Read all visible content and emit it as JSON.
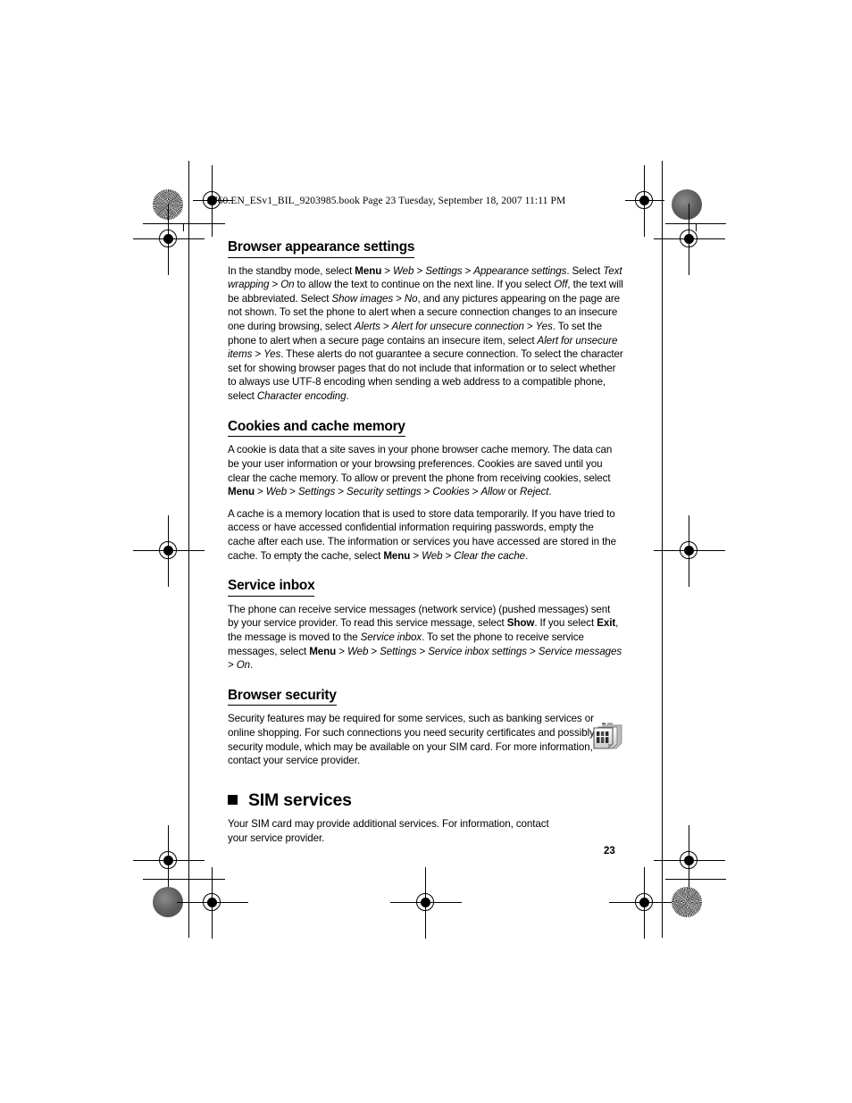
{
  "page": {
    "running_header": "2760.EN_ESv1_BIL_9203985.book  Page 23  Tuesday, September 18, 2007  11:11 PM",
    "folio": "23",
    "background_color": "#ffffff",
    "text_color": "#000000"
  },
  "sections": [
    {
      "id": "browser-appearance-settings",
      "heading": "Browser appearance settings",
      "paragraphs": [
        {
          "runs": [
            {
              "text": "In the standby mode, select ",
              "style": "normal"
            },
            {
              "text": "Menu",
              "style": "bold"
            },
            {
              "text": " > ",
              "style": "normal"
            },
            {
              "text": "Web",
              "style": "italic"
            },
            {
              "text": " > ",
              "style": "normal"
            },
            {
              "text": "Settings",
              "style": "italic"
            },
            {
              "text": " > ",
              "style": "normal"
            },
            {
              "text": "Appearance settings",
              "style": "italic"
            },
            {
              "text": ". Select ",
              "style": "normal"
            },
            {
              "text": "Text wrapping",
              "style": "italic"
            },
            {
              "text": " > ",
              "style": "normal"
            },
            {
              "text": "On",
              "style": "italic"
            },
            {
              "text": " to allow the text to continue on the next line. If you select ",
              "style": "normal"
            },
            {
              "text": "Off",
              "style": "italic"
            },
            {
              "text": ", the text will be abbreviated. Select ",
              "style": "normal"
            },
            {
              "text": "Show images",
              "style": "italic"
            },
            {
              "text": " > ",
              "style": "normal"
            },
            {
              "text": "No",
              "style": "italic"
            },
            {
              "text": ", and any pictures appearing on the page are not shown. To set the phone to alert when a secure connection changes to an insecure one during browsing, select ",
              "style": "normal"
            },
            {
              "text": "Alerts",
              "style": "italic"
            },
            {
              "text": " > ",
              "style": "normal"
            },
            {
              "text": "Alert for unsecure connection",
              "style": "italic"
            },
            {
              "text": " > ",
              "style": "normal"
            },
            {
              "text": "Yes",
              "style": "italic"
            },
            {
              "text": ". To set the phone to alert when a secure page contains an insecure item, select ",
              "style": "normal"
            },
            {
              "text": "Alert for unsecure items",
              "style": "italic"
            },
            {
              "text": " > ",
              "style": "normal"
            },
            {
              "text": "Yes",
              "style": "italic"
            },
            {
              "text": ". These alerts do not guarantee a secure connection. To select the character set for showing browser pages that do not include that information or to select whether to always use UTF-8 encoding when sending a web address to a compatible phone, select ",
              "style": "normal"
            },
            {
              "text": "Character encoding",
              "style": "italic"
            },
            {
              "text": ".",
              "style": "normal"
            }
          ]
        }
      ]
    },
    {
      "id": "cookies-and-cache-memory",
      "heading": "Cookies and cache memory",
      "paragraphs": [
        {
          "runs": [
            {
              "text": "A cookie is data that a site saves in your phone browser cache memory. The data can be your user information or your browsing preferences. Cookies are saved until you clear the cache memory. To allow or prevent the phone from receiving cookies, select ",
              "style": "normal"
            },
            {
              "text": "Menu",
              "style": "bold"
            },
            {
              "text": " > ",
              "style": "normal"
            },
            {
              "text": "Web",
              "style": "italic"
            },
            {
              "text": " > ",
              "style": "normal"
            },
            {
              "text": "Settings",
              "style": "italic"
            },
            {
              "text": " > ",
              "style": "normal"
            },
            {
              "text": "Security settings",
              "style": "italic"
            },
            {
              "text": " > ",
              "style": "normal"
            },
            {
              "text": "Cookies",
              "style": "italic"
            },
            {
              "text": " > ",
              "style": "normal"
            },
            {
              "text": "Allow",
              "style": "italic"
            },
            {
              "text": " or ",
              "style": "normal"
            },
            {
              "text": "Reject",
              "style": "italic"
            },
            {
              "text": ".",
              "style": "normal"
            }
          ]
        },
        {
          "runs": [
            {
              "text": "A cache is a memory location that is used to store data temporarily. If you have tried to access or have accessed confidential information requiring passwords, empty the cache after each use. The information or services you have accessed are stored in the cache. To empty the cache, select ",
              "style": "normal"
            },
            {
              "text": "Menu",
              "style": "bold"
            },
            {
              "text": " > ",
              "style": "normal"
            },
            {
              "text": "Web",
              "style": "italic"
            },
            {
              "text": " > ",
              "style": "normal"
            },
            {
              "text": "Clear the cache",
              "style": "italic"
            },
            {
              "text": ".",
              "style": "normal"
            }
          ]
        }
      ]
    },
    {
      "id": "service-inbox",
      "heading": "Service inbox",
      "paragraphs": [
        {
          "runs": [
            {
              "text": "The phone can receive service messages (network service) (pushed messages) sent by your service provider. To read this service message, select ",
              "style": "normal"
            },
            {
              "text": "Show",
              "style": "bold"
            },
            {
              "text": ". If you select ",
              "style": "normal"
            },
            {
              "text": "Exit",
              "style": "bold"
            },
            {
              "text": ", the message is moved to the ",
              "style": "normal"
            },
            {
              "text": "Service inbox",
              "style": "italic"
            },
            {
              "text": ". To set the phone to receive service messages, select ",
              "style": "normal"
            },
            {
              "text": "Menu",
              "style": "bold"
            },
            {
              "text": " > ",
              "style": "normal"
            },
            {
              "text": "Web",
              "style": "italic"
            },
            {
              "text": " > ",
              "style": "normal"
            },
            {
              "text": "Settings",
              "style": "italic"
            },
            {
              "text": " > ",
              "style": "normal"
            },
            {
              "text": "Service inbox settings",
              "style": "italic"
            },
            {
              "text": " > ",
              "style": "normal"
            },
            {
              "text": "Service messages",
              "style": "italic"
            },
            {
              "text": " > ",
              "style": "normal"
            },
            {
              "text": "On",
              "style": "italic"
            },
            {
              "text": ".",
              "style": "normal"
            }
          ]
        }
      ]
    },
    {
      "id": "browser-security",
      "heading": "Browser security",
      "paragraphs": [
        {
          "runs": [
            {
              "text": "Security features may be required for some services, such as banking services or online shopping. For such connections you need security certificates and possibly a security module, which may be available on your SIM card. For more information, contact your service provider.",
              "style": "normal"
            }
          ]
        }
      ]
    }
  ],
  "chapter": {
    "id": "sim-services",
    "title": "SIM services",
    "icon_name": "sim-card-icon",
    "paragraphs": [
      {
        "runs": [
          {
            "text": "Your SIM card may provide additional services. For information, contact your service provider.",
            "style": "normal"
          }
        ]
      }
    ]
  }
}
